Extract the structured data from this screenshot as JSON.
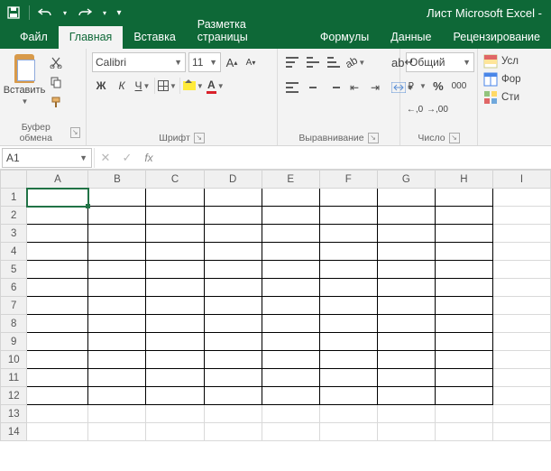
{
  "title": "Лист Microsoft Excel -",
  "qat": {
    "save": "save",
    "undo": "undo",
    "redo": "redo"
  },
  "tabs": {
    "file": "Файл",
    "home": "Главная",
    "insert": "Вставка",
    "layout": "Разметка страницы",
    "formulas": "Формулы",
    "data": "Данные",
    "review": "Рецензирование"
  },
  "ribbon": {
    "clipboard": {
      "paste": "Вставить",
      "label": "Буфер обмена"
    },
    "font": {
      "name": "Calibri",
      "size": "11",
      "bold": "Ж",
      "italic": "К",
      "underline": "Ч",
      "inc": "A",
      "dec": "A",
      "fontcolor": "A",
      "label": "Шрифт"
    },
    "align": {
      "wrap": "ab",
      "label": "Выравнивание"
    },
    "number": {
      "format": "Общий",
      "decInc": ",0",
      "decDec": ",00",
      "thousand": "000",
      "pct": "%",
      "label": "Число"
    },
    "styles": {
      "cond": "Усл",
      "table": "Фор",
      "cell": "Сти"
    }
  },
  "namebox": "A1",
  "fx_label": "fx",
  "grid": {
    "cols": [
      "A",
      "B",
      "C",
      "D",
      "E",
      "F",
      "G",
      "H",
      "I"
    ],
    "rows": [
      1,
      2,
      3,
      4,
      5,
      6,
      7,
      8,
      9,
      10,
      11,
      12,
      13,
      14
    ],
    "selected": "A1",
    "bordered_cols": 8,
    "bordered_rows": 12
  }
}
